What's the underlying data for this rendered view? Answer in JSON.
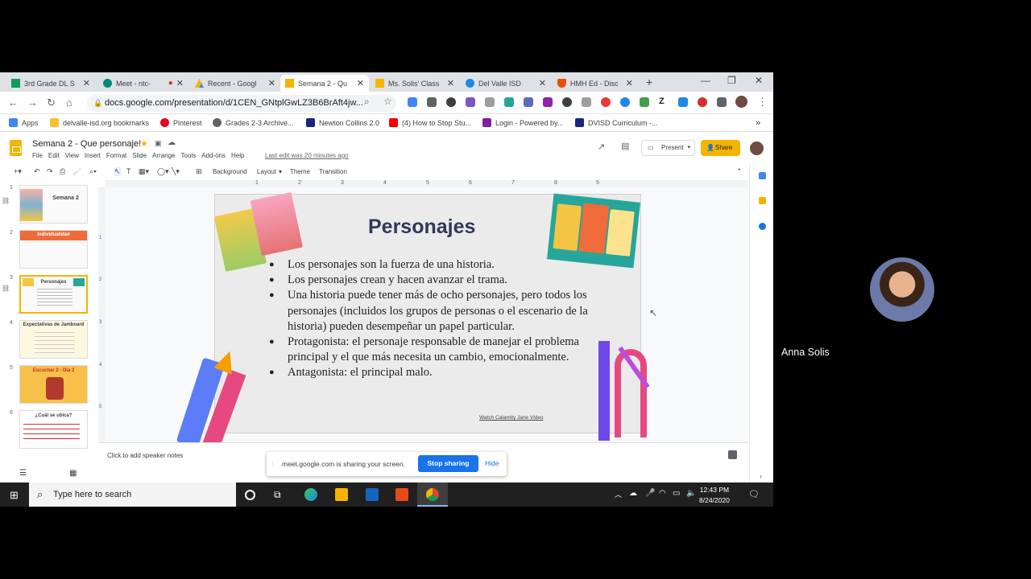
{
  "browser": {
    "tabs": [
      {
        "label": "3rd Grade DL S",
        "icon_color": "#0f9d58"
      },
      {
        "label": "Meet - ntc-",
        "icon_color": "#00897b"
      },
      {
        "label": "Recent - Googl",
        "icon_color": "#4285f4"
      },
      {
        "label": "Semana 2 - Qu",
        "icon_color": "#f4b400"
      },
      {
        "label": "Ms. Solis' Class",
        "icon_color": "#f4b400"
      },
      {
        "label": "Del Valle ISD",
        "icon_color": "#1e88e5"
      },
      {
        "label": "HMH Ed - Disc",
        "icon_color": "#e65100"
      }
    ],
    "url": "docs.google.com/presentation/d/1CEN_GNtplGwLZ3B6BrAft4jw...",
    "bookmarks": [
      {
        "label": "Apps",
        "icon_color": "#4285f4"
      },
      {
        "label": "delvalle-isd.org bookmarks",
        "icon_color": "#fbc02d"
      },
      {
        "label": "Pinterest",
        "icon_color": "#e60023"
      },
      {
        "label": "Grades 2-3 Archive...",
        "icon_color": "#5f6368"
      },
      {
        "label": "Newton Collins 2.0",
        "icon_color": "#1a237e"
      },
      {
        "label": "(4) How to Stop Stu...",
        "icon_color": "#ff0000"
      },
      {
        "label": "Login - Powered by...",
        "icon_color": "#7b1fa2"
      },
      {
        "label": "DVISD Curriculum -...",
        "icon_color": "#1a237e"
      }
    ]
  },
  "doc": {
    "title": "Semana 2 - Que personaje!",
    "menus": [
      "File",
      "Edit",
      "View",
      "Insert",
      "Format",
      "Slide",
      "Arrange",
      "Tools",
      "Add-ons",
      "Help"
    ],
    "last_edit": "Last edit was 20 minutes ago",
    "present_label": "Present",
    "share_label": "Share",
    "toolbar": {
      "background": "Background",
      "layout": "Layout",
      "theme": "Theme",
      "transition": "Transition"
    }
  },
  "ruler": [
    "1",
    "2",
    "3",
    "4",
    "5",
    "6",
    "7",
    "8",
    "9"
  ],
  "vruler": [
    "1",
    "2",
    "3",
    "4",
    "5"
  ],
  "thumbnails": [
    {
      "num": "1",
      "label": "Semana 2"
    },
    {
      "num": "2",
      "label": "Individualidad"
    },
    {
      "num": "3",
      "label": "Personajes"
    },
    {
      "num": "4",
      "label": "Expectativas de Jamboard"
    },
    {
      "num": "5",
      "label": "Escuchar 2 - Día 2"
    },
    {
      "num": "6",
      "label": "¿Cuál se ubica?"
    }
  ],
  "slide": {
    "title": "Personajes",
    "bullets": [
      "Los personajes son la fuerza de una historia.",
      "Los personajes crean y hacen avanzar el trama.",
      "Una historia puede tener más de ocho personajes, pero todos los personajes (incluidos los grupos de personas o el escenario de la historia) pueden desempeñar un papel particular.",
      "Protagonista: el personaje responsable de manejar el problema principal y el que más necesita un cambio, emocionalmente.",
      "Antagonista: el principal malo."
    ],
    "link": "Watch Calamity Jane Video"
  },
  "speaker_notes": "Click to add speaker notes",
  "share_bar": {
    "message": "meet.google.com is sharing your screen.",
    "stop": "Stop sharing",
    "hide": "Hide"
  },
  "taskbar": {
    "search_placeholder": "Type here to search",
    "time": "12:43 PM",
    "date": "8/24/2020"
  },
  "presenter": {
    "name": "Anna Solis"
  }
}
